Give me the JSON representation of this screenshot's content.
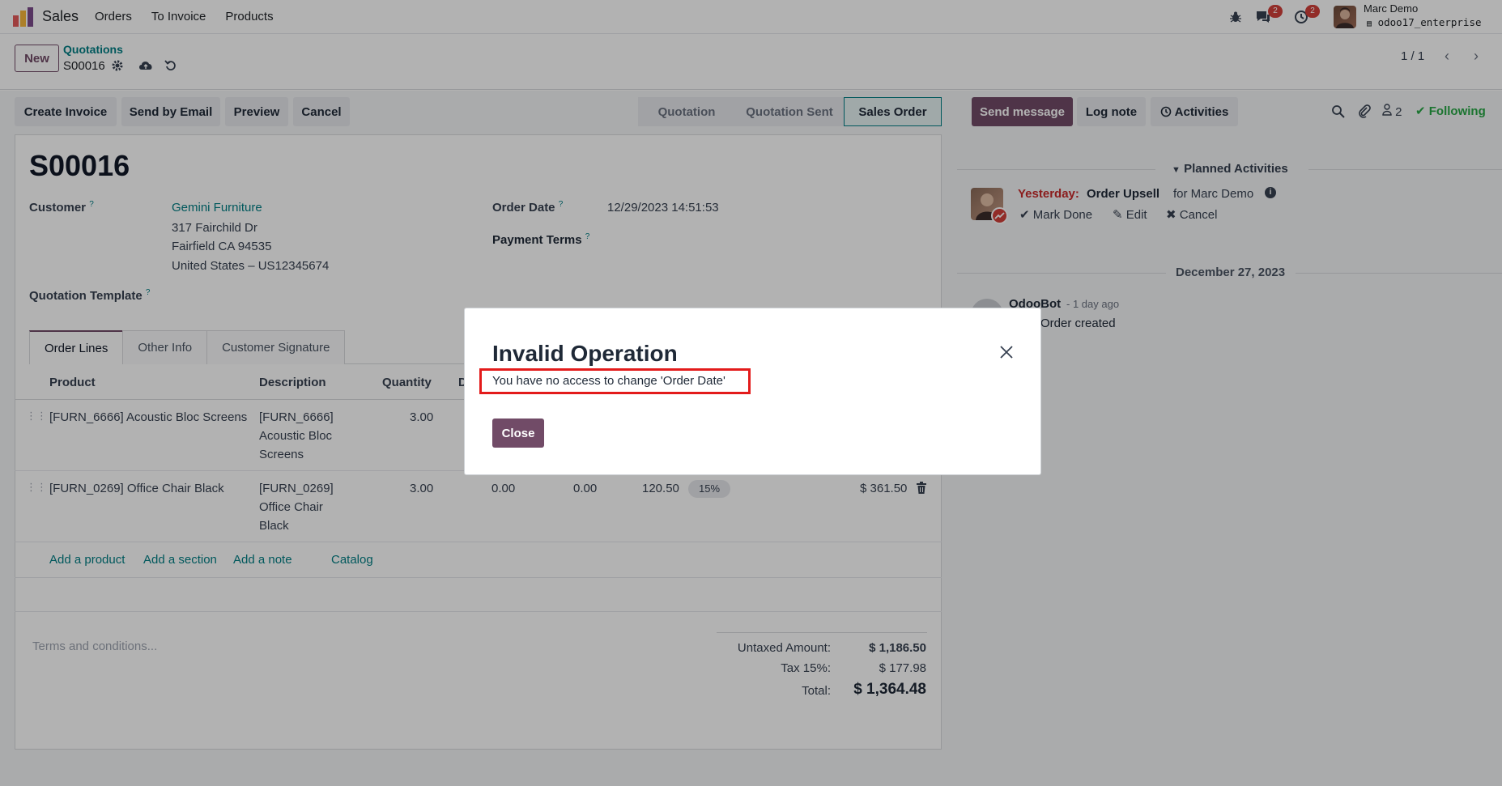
{
  "navbar": {
    "app_name": "Sales",
    "menu": [
      "Orders",
      "To Invoice",
      "Products"
    ],
    "chat_count": "2",
    "activity_count": "2",
    "user_name": "Marc Demo",
    "db_name": "odoo17_enterprise"
  },
  "control_panel": {
    "new_label": "New",
    "breadcrumb_parent": "Quotations",
    "breadcrumb_current": "S00016",
    "pager": "1 / 1"
  },
  "actions": [
    "Create Invoice",
    "Send by Email",
    "Preview",
    "Cancel"
  ],
  "stages": [
    "Quotation",
    "Quotation Sent",
    "Sales Order"
  ],
  "form": {
    "title": "S00016",
    "customer_label": "Customer",
    "customer_name": "Gemini Furniture",
    "address_1": "317 Fairchild Dr",
    "address_2": "Fairfield CA 94535",
    "address_3": "United States – US12345674",
    "template_label": "Quotation Template",
    "order_date_label": "Order Date",
    "order_date": "12/29/2023 14:51:53",
    "payment_terms_label": "Payment Terms",
    "help_mark": "?"
  },
  "tabs": [
    "Order Lines",
    "Other Info",
    "Customer Signature"
  ],
  "table": {
    "headers": {
      "product": "Product",
      "description": "Description",
      "quantity": "Quantity",
      "d": "D"
    },
    "rows": [
      {
        "product": "[FURN_6666] Acoustic Bloc Screens",
        "desc_1": "[FURN_6666]",
        "desc_2": "Acoustic Bloc",
        "desc_3": "Screens",
        "quantity": "3.00"
      },
      {
        "product": "[FURN_0269] Office Chair Black",
        "desc_1": "[FURN_0269]",
        "desc_2": "Office Chair",
        "desc_3": "Black",
        "quantity": "3.00",
        "delivered": "0.00",
        "invoiced": "0.00",
        "unit_price": "120.50",
        "tax": "15%",
        "subtotal": "$ 361.50"
      }
    ],
    "add_product": "Add a product",
    "add_section": "Add a section",
    "add_note": "Add a note",
    "catalog": "Catalog"
  },
  "footer": {
    "terms_placeholder": "Terms and conditions...",
    "untaxed_label": "Untaxed Amount:",
    "untaxed_value": "$ 1,186.50",
    "tax_label": "Tax 15%:",
    "tax_value": "$ 177.98",
    "total_label": "Total:",
    "total_value": "$ 1,364.48"
  },
  "chatter": {
    "send_message": "Send message",
    "log_note": "Log note",
    "activities": "Activities",
    "followers_count": "2",
    "following": "Following",
    "planned_title": "Planned Activities",
    "activity_when": "Yesterday:",
    "activity_name": "Order Upsell",
    "activity_for": "for Marc Demo",
    "mark_done": "Mark Done",
    "edit": "Edit",
    "cancel": "Cancel",
    "date_sep": "December 27, 2023",
    "msg_author": "OdooBot",
    "msg_time": "- 1 day ago",
    "msg_body": "Order created"
  },
  "dialog": {
    "title": "Invalid Operation",
    "message": "You have no access to change 'Order Date'",
    "close_label": "Close"
  },
  "colors": {
    "brand": "#714b67",
    "link": "#017e84",
    "highlight_box": "#e31b1b",
    "badge": "#d23f3a"
  }
}
